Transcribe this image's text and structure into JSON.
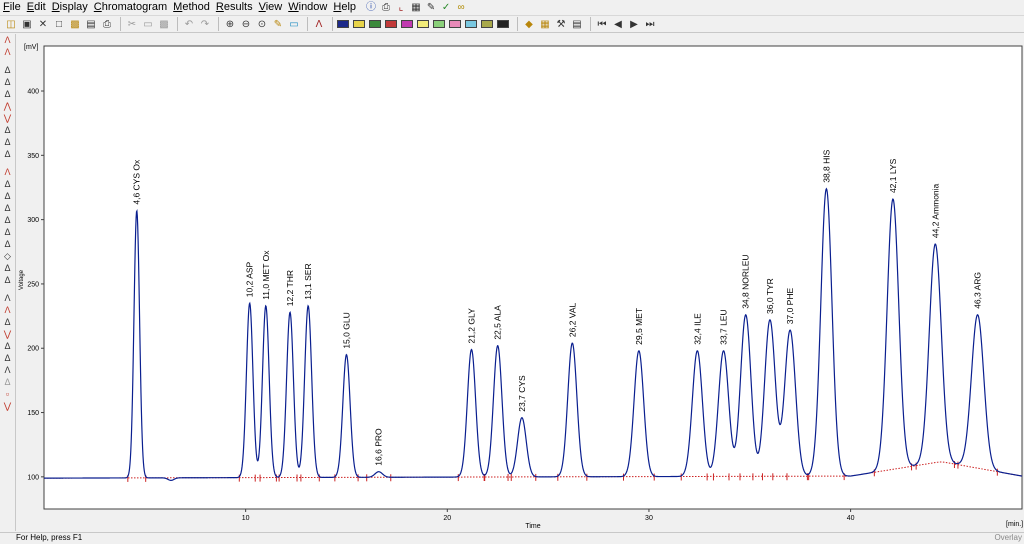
{
  "menu": [
    "File",
    "Edit",
    "Display",
    "Chromatogram",
    "Method",
    "Results",
    "View",
    "Window",
    "Help"
  ],
  "status": {
    "left": "For Help, press F1",
    "right": "Overlay"
  },
  "chart_data": {
    "type": "line",
    "xlabel": "Time",
    "ylabel": "Voltage",
    "x_unit": "[min.]",
    "y_unit": "[mV]",
    "xlim": [
      0,
      48.5
    ],
    "ylim": [
      75,
      435
    ],
    "x_ticks": [
      10,
      20,
      30,
      40
    ],
    "y_ticks": [
      100,
      150,
      200,
      250,
      300,
      350,
      400
    ],
    "line_color": "#0a1f8f",
    "baseline_color": "#cc2222",
    "peaks": [
      {
        "rt": 4.6,
        "height": 307,
        "label": "4,6 CYS Ox"
      },
      {
        "rt": 10.2,
        "height": 235,
        "label": "10,2 ASP"
      },
      {
        "rt": 11.0,
        "height": 233,
        "label": "11,0 MET Ox"
      },
      {
        "rt": 12.2,
        "height": 228,
        "label": "12,2 THR"
      },
      {
        "rt": 13.1,
        "height": 233,
        "label": "13,1 SER"
      },
      {
        "rt": 15.0,
        "height": 195,
        "label": "15,0 GLU"
      },
      {
        "rt": 16.6,
        "height": 104,
        "label": "16,6 PRO"
      },
      {
        "rt": 21.2,
        "height": 199,
        "label": "21,2 GLY"
      },
      {
        "rt": 22.5,
        "height": 202,
        "label": "22,5 ALA"
      },
      {
        "rt": 23.7,
        "height": 146,
        "label": "23,7 CYS"
      },
      {
        "rt": 26.2,
        "height": 204,
        "label": "26,2 VAL"
      },
      {
        "rt": 29.5,
        "height": 198,
        "label": "29,5 MET"
      },
      {
        "rt": 32.4,
        "height": 198,
        "label": "32,4 ILE"
      },
      {
        "rt": 33.7,
        "height": 198,
        "label": "33,7 LEU"
      },
      {
        "rt": 34.8,
        "height": 226,
        "label": "34,8 NORLEU"
      },
      {
        "rt": 36.0,
        "height": 222,
        "label": "36,0 TYR"
      },
      {
        "rt": 37.0,
        "height": 214,
        "label": "37,0 PHE"
      },
      {
        "rt": 38.8,
        "height": 324,
        "label": "38,8 HIS"
      },
      {
        "rt": 42.1,
        "height": 316,
        "label": "42,1 LYS"
      },
      {
        "rt": 44.2,
        "height": 281,
        "label": "44,2 Ammonia"
      },
      {
        "rt": 46.3,
        "height": 226,
        "label": "46,3 ARG"
      }
    ]
  }
}
